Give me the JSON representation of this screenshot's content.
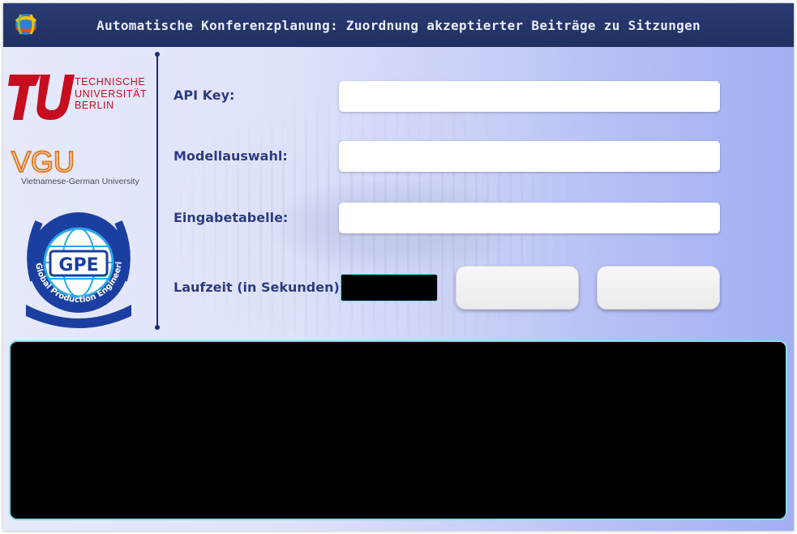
{
  "window": {
    "title": "Automatische Konferenzplanung: Zuordnung akzeptierter Beiträge zu Sitzungen"
  },
  "logos": {
    "tu": {
      "line1": "TECHNISCHE",
      "line2": "UNIVERSITÄT",
      "line3": "BERLIN"
    },
    "vgu": {
      "mark": "VGU",
      "subtitle": "Vietnamese-German University"
    },
    "gpe": {
      "mark": "GPE",
      "ring_text": "Global Production Engineering"
    }
  },
  "form": {
    "api_key": {
      "label": "API Key:",
      "value": "",
      "placeholder": ""
    },
    "model": {
      "label": "Modellauswahl:",
      "value": "",
      "placeholder": ""
    },
    "input_table": {
      "label": "Eingabetabelle:",
      "value": "",
      "placeholder": ""
    },
    "runtime": {
      "label": "Laufzeit (in Sekunden)",
      "value": ""
    }
  },
  "buttons": {
    "button1_label": "",
    "button2_label": "",
    "icon": "app-globe-icon"
  },
  "output": {
    "value": ""
  },
  "colors": {
    "titlebar": "#22346a",
    "label": "#2b3a80",
    "divider": "#1e2c78",
    "tu_red": "#c50e1f",
    "gpe_blue": "#1b3fa0",
    "output_border": "#7ee0e6"
  }
}
